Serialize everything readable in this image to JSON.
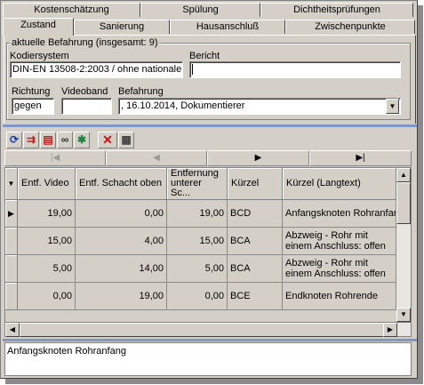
{
  "tabs_back": [
    "Kostenschätzung",
    "Spülung",
    "Dichtheitsprüfungen"
  ],
  "tabs_front": [
    "Zustand",
    "Sanierung",
    "Hausanschluß",
    "Zwischenpunkte"
  ],
  "group": {
    "title": "aktuelle Befahrung (insgesamt: 9)",
    "kodiersystem_label": "Kodiersystem",
    "kodiersystem_value": "DIN-EN 13508-2:2003 / ohne nationale",
    "bericht_label": "Bericht",
    "bericht_value": "",
    "richtung_label": "Richtung",
    "richtung_value": "gegen",
    "videoband_label": "Videoband",
    "videoband_value": "",
    "befahrung_label": "Befahrung",
    "befahrung_value": ", 16.10.2014, Dokumentierer"
  },
  "toolbar_icons": [
    "refresh-icon",
    "add-rows-icon",
    "copy-icon",
    "find-icon",
    "settings-icon",
    "delete-icon",
    "grid-icon"
  ],
  "nav": {
    "first": "|◀",
    "prev": "◀",
    "next": "▶",
    "last": "▶|"
  },
  "table": {
    "columns": [
      "Entf. Video",
      "Entf. Schacht oben",
      "Entfernung unterer Sc...",
      "Kürzel",
      "Kürzel (Langtext)"
    ],
    "rows": [
      {
        "indicator": "▶",
        "video": "19,00",
        "schacht": "0,00",
        "unterer": "19,00",
        "kuerzel": "BCD",
        "langtext": "Anfangsknoten Rohranfang"
      },
      {
        "indicator": "",
        "video": "15,00",
        "schacht": "4,00",
        "unterer": "15,00",
        "kuerzel": "BCA",
        "langtext": "Abzweig - Rohr mit einem Anschluss: offen"
      },
      {
        "indicator": "",
        "video": "5,00",
        "schacht": "14,00",
        "unterer": "5,00",
        "kuerzel": "BCA",
        "langtext": "Abzweig - Rohr mit einem Anschluss: offen"
      },
      {
        "indicator": "",
        "video": "0,00",
        "schacht": "19,00",
        "unterer": "0,00",
        "kuerzel": "BCE",
        "langtext": "Endknoten Rohrende"
      }
    ]
  },
  "memo_text": "Anfangsknoten Rohranfang",
  "colors": {
    "window": "#d4d0c8",
    "separator": "#7f97c8"
  }
}
